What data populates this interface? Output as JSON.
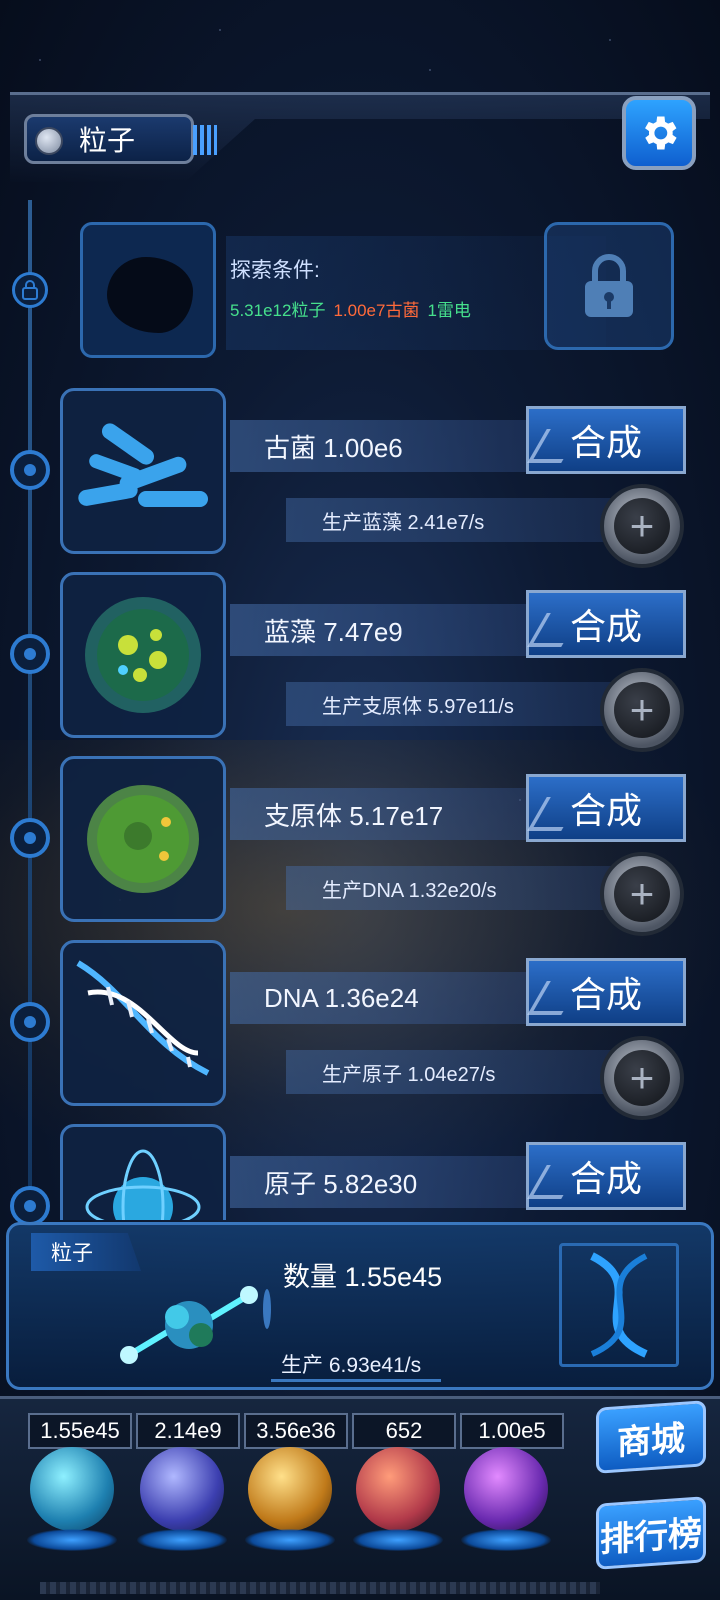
{
  "header": {
    "title": "粒子"
  },
  "locked": {
    "label": "探索条件:",
    "conditions": [
      "5.31e12粒子",
      "1.00e7古菌",
      "1雷电"
    ],
    "cond_colors": [
      "#46e08c",
      "#ff6a3a",
      "#46e08c"
    ]
  },
  "items": [
    {
      "name": "古菌 1.00e6",
      "button": "合成",
      "production": "生产蓝藻 2.41e7/s"
    },
    {
      "name": "蓝藻 7.47e9",
      "button": "合成",
      "production": "生产支原体 5.97e11/s"
    },
    {
      "name": "支原体 5.17e17",
      "button": "合成",
      "production": "生产DNA 1.32e20/s"
    },
    {
      "name": "DNA 1.36e24",
      "button": "合成",
      "production": "生产原子 1.04e27/s"
    },
    {
      "name": "原子 5.82e30",
      "button": "合成",
      "production": ""
    }
  ],
  "panel": {
    "tag": "粒子",
    "quantity": "数量 1.55e45",
    "rate": "生产 6.93e41/s"
  },
  "resources": {
    "values": [
      "1.55e45",
      "2.14e9",
      "3.56e36",
      "652",
      "1.00e5"
    ],
    "shop": "商城",
    "rank": "排行榜"
  }
}
